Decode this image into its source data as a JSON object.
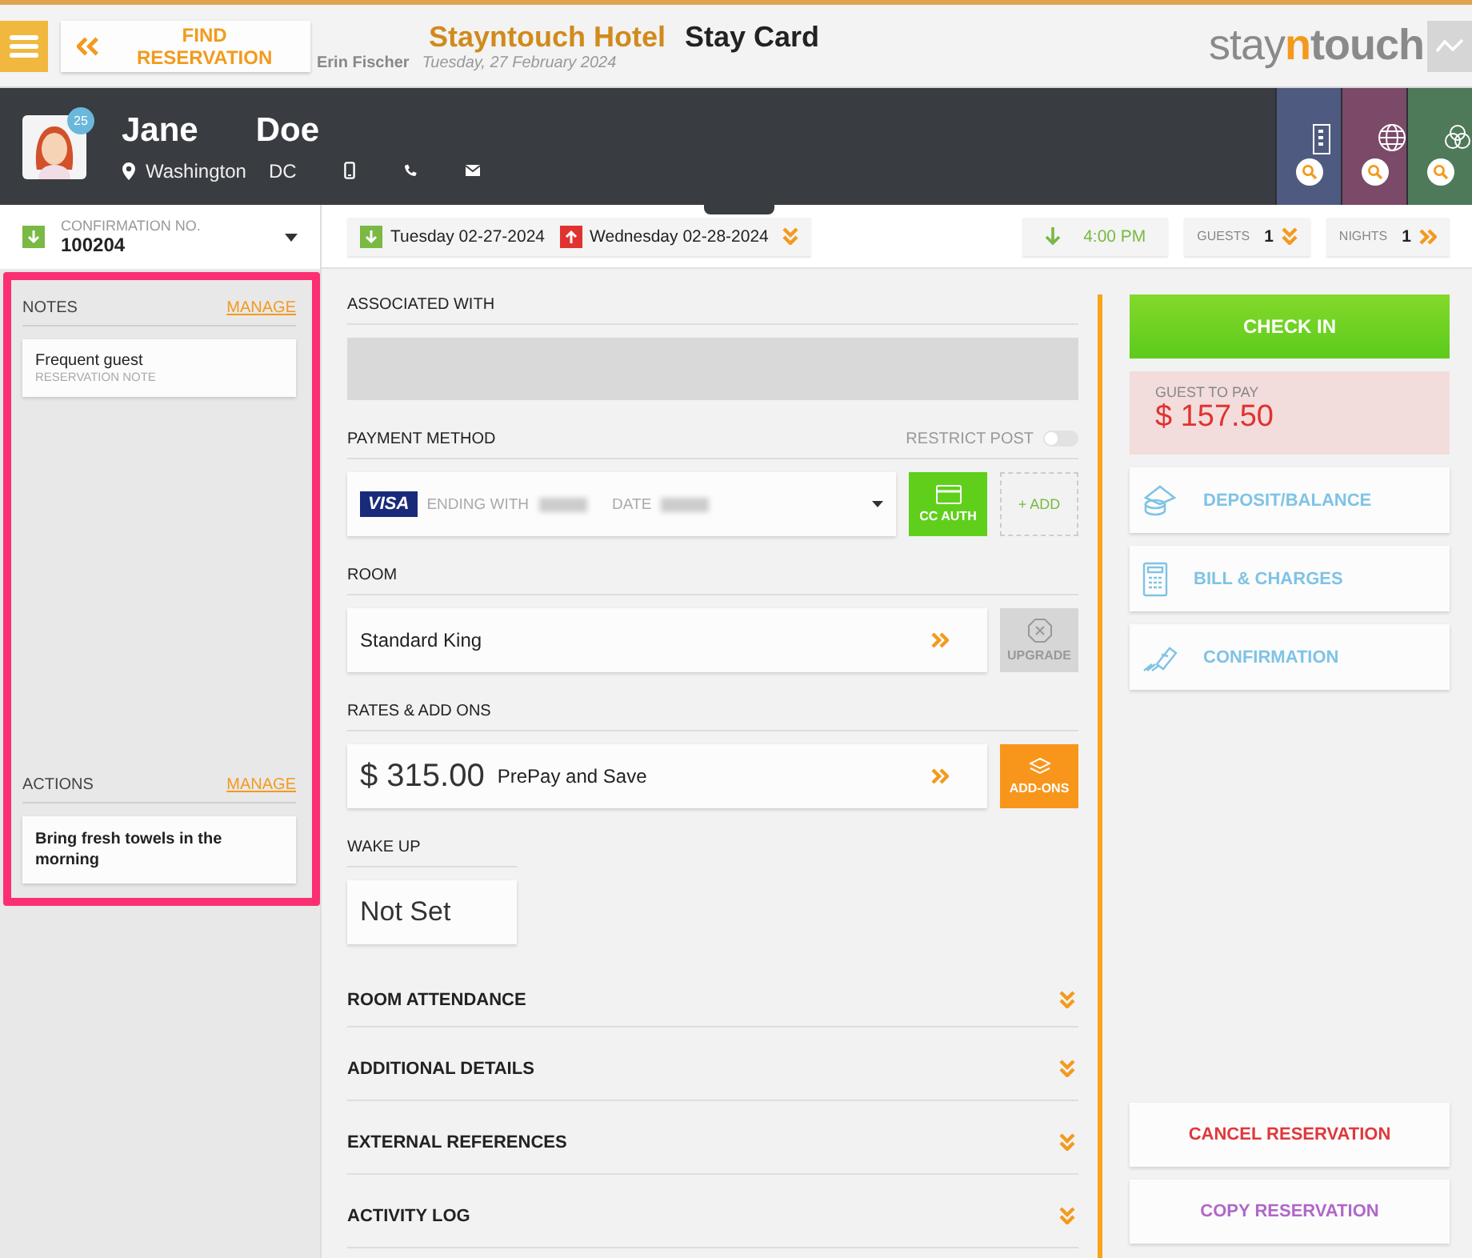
{
  "header": {
    "back_label": "FIND RESERVATION",
    "hotel": "Stayntouch Hotel",
    "page_title": "Stay Card",
    "user": "Erin Fischer",
    "date": "Tuesday, 27 February 2024",
    "logo": [
      {
        "text": "stay",
        "kind": "light"
      },
      {
        "text": "n",
        "kind": "accent"
      },
      {
        "text": "touch",
        "kind": "strong"
      }
    ]
  },
  "guest": {
    "first_name": "Jane",
    "last_name": "Doe",
    "badge": "25",
    "city": "Washington",
    "state": "DC"
  },
  "profile_tiles": [
    {
      "kind": "company",
      "color": "#4f5a80"
    },
    {
      "kind": "travel_agent",
      "color": "#7a4a68"
    },
    {
      "kind": "group",
      "color": "#4f7a5a"
    }
  ],
  "confirmation": {
    "label": "CONFIRMATION NO.",
    "number": "100204"
  },
  "stay": {
    "arrival": "Tuesday 02-27-2024",
    "departure": "Wednesday 02-28-2024",
    "arrival_time": "4:00 PM",
    "guests_label": "GUESTS",
    "guests": "1",
    "nights_label": "NIGHTS",
    "nights": "1"
  },
  "notes": {
    "title": "NOTES",
    "manage": "MANAGE",
    "items": [
      {
        "text": "Frequent guest",
        "type": "RESERVATION NOTE"
      }
    ]
  },
  "actions": {
    "title": "ACTIONS",
    "manage": "MANAGE",
    "items": [
      {
        "text": "Bring fresh towels in the morning"
      }
    ]
  },
  "associated": {
    "title": "ASSOCIATED WITH"
  },
  "payment": {
    "title": "PAYMENT METHOD",
    "restrict_label": "RESTRICT POST",
    "restrict_on": false,
    "card_brand": "VISA",
    "ending_label": "ENDING WITH",
    "date_label": "DATE",
    "cc_auth": "CC AUTH",
    "add": "+ ADD"
  },
  "room": {
    "title": "ROOM",
    "type": "Standard King",
    "upgrade": "UPGRADE",
    "upgrade_disabled": true
  },
  "rates": {
    "title": "RATES & ADD ONS",
    "amount": "$ 315.00",
    "rate_name": "PrePay and Save",
    "addons": "ADD-ONS"
  },
  "wake_up": {
    "title": "WAKE UP",
    "value": "Not Set"
  },
  "sections": [
    {
      "title": "ROOM ATTENDANCE",
      "expanded": false
    },
    {
      "title": "ADDITIONAL DETAILS",
      "expanded": false
    },
    {
      "title": "EXTERNAL REFERENCES",
      "expanded": false
    },
    {
      "title": "ACTIVITY LOG",
      "expanded": false
    }
  ],
  "side": {
    "check_in": "CHECK IN",
    "balance_label": "GUEST TO PAY",
    "balance": "$ 157.50",
    "links": [
      {
        "kind": "deposit",
        "label": "DEPOSIT/BALANCE"
      },
      {
        "kind": "bill",
        "label": "BILL & CHARGES"
      },
      {
        "kind": "confirmation",
        "label": "CONFIRMATION"
      }
    ],
    "cancel": "CANCEL RESERVATION",
    "copy": "COPY RESERVATION"
  }
}
